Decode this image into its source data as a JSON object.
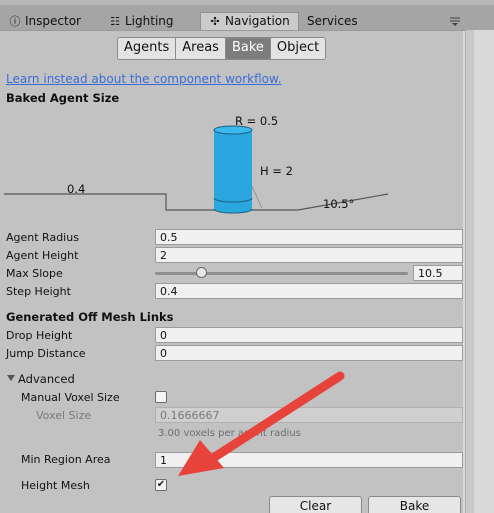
{
  "tabs": [
    {
      "label": "Inspector",
      "icon": "info-icon"
    },
    {
      "label": "Lighting",
      "icon": "lighting-icon"
    },
    {
      "label": "Navigation",
      "icon": "navigation-icon",
      "active": true
    },
    {
      "label": "Services",
      "icon": ""
    }
  ],
  "mode_buttons": {
    "agents": "Agents",
    "areas": "Areas",
    "bake": "Bake",
    "object": "Object",
    "selected": "Bake"
  },
  "workflow_link": "Learn instead about the component workflow.",
  "baked_agent": {
    "header": "Baked Agent Size",
    "diagram": {
      "radius_label": "R = 0.5",
      "height_label": "H = 2",
      "step_label": "0.4",
      "slope_label": "10.5°",
      "agent_color": "#2aa7df"
    }
  },
  "fields": {
    "agent_radius": {
      "label": "Agent Radius",
      "value": "0.5"
    },
    "agent_height": {
      "label": "Agent Height",
      "value": "2"
    },
    "max_slope": {
      "label": "Max Slope",
      "value": "10.5",
      "slider_fraction": 0.233
    },
    "step_height": {
      "label": "Step Height",
      "value": "0.4"
    }
  },
  "offmesh": {
    "header": "Generated Off Mesh Links",
    "drop_height": {
      "label": "Drop Height",
      "value": "0"
    },
    "jump_distance": {
      "label": "Jump Distance",
      "value": "0"
    }
  },
  "advanced": {
    "header": "Advanced",
    "manual_voxel": {
      "label": "Manual Voxel Size",
      "checked": false
    },
    "voxel_size": {
      "label": "Voxel Size",
      "value": "0.1666667"
    },
    "voxel_hint": "3.00 voxels per agent radius",
    "min_region": {
      "label": "Min Region Area",
      "value": "1"
    },
    "height_mesh": {
      "label": "Height Mesh",
      "checked": true
    }
  },
  "actions": {
    "clear": "Clear",
    "bake": "Bake"
  },
  "annotation": {
    "color": "#e8433a"
  }
}
